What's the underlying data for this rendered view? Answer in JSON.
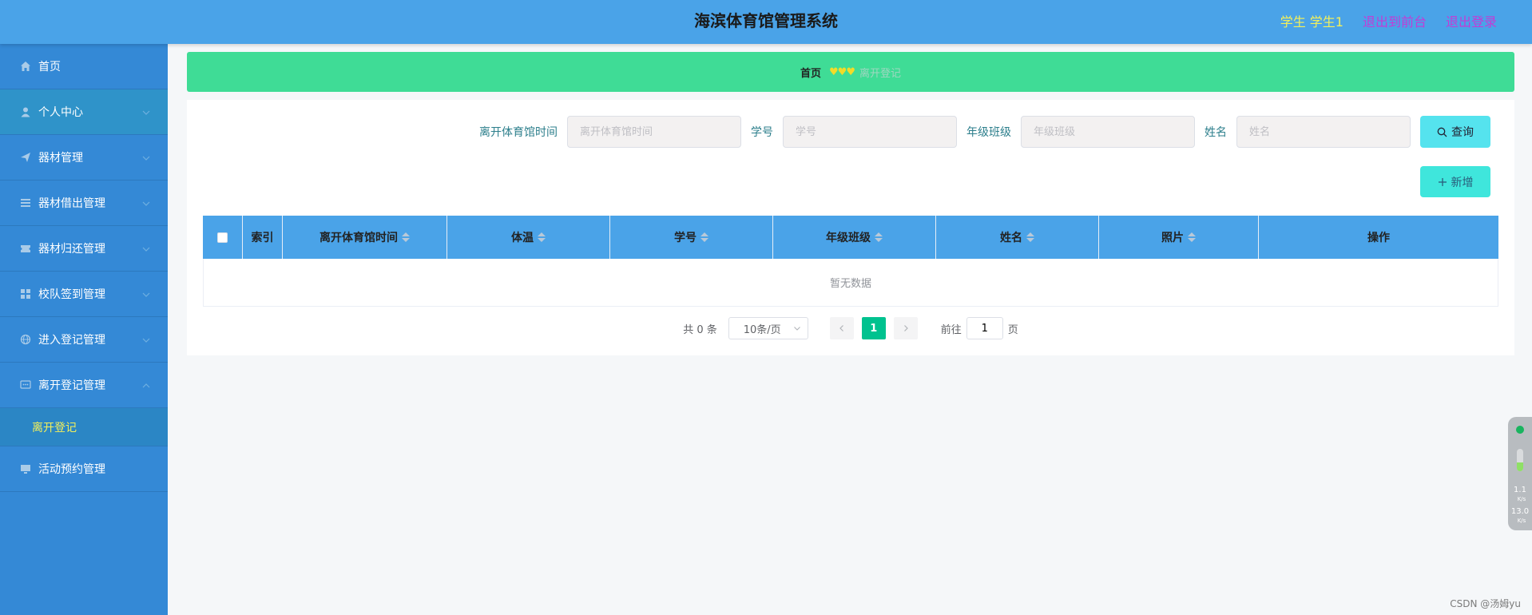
{
  "header": {
    "title": "海滨体育馆管理系统",
    "user": "学生 学生1",
    "exit_front": "退出到前台",
    "logout": "退出登录",
    "colors": {
      "bg": "#4aa3e8",
      "user": "#f4f05a",
      "link": "#c33bd6"
    }
  },
  "sidebar": {
    "items": [
      {
        "label": "首页",
        "icon": "home-icon"
      },
      {
        "label": "个人中心",
        "icon": "user-icon"
      },
      {
        "label": "器材管理",
        "icon": "send-icon"
      },
      {
        "label": "器材借出管理",
        "icon": "list-icon"
      },
      {
        "label": "器材归还管理",
        "icon": "ticket-icon"
      },
      {
        "label": "校队签到管理",
        "icon": "grid-icon"
      },
      {
        "label": "进入登记管理",
        "icon": "globe-icon"
      },
      {
        "label": "离开登记管理",
        "icon": "chat-icon"
      },
      {
        "label": "活动预约管理",
        "icon": "monitor-icon"
      }
    ],
    "sub_item": "离开登记"
  },
  "breadcrumb": {
    "home": "首页",
    "hearts": "♥♥♥",
    "current": "离开登记"
  },
  "search": {
    "fields": [
      {
        "label": "离开体育馆时间",
        "placeholder": "离开体育馆时间"
      },
      {
        "label": "学号",
        "placeholder": "学号"
      },
      {
        "label": "年级班级",
        "placeholder": "年级班级"
      },
      {
        "label": "姓名",
        "placeholder": "姓名"
      }
    ],
    "query_label": "查询",
    "add_label": "新增"
  },
  "table": {
    "columns": [
      "索引",
      "离开体育馆时间",
      "体温",
      "学号",
      "年级班级",
      "姓名",
      "照片",
      "操作"
    ],
    "empty_text": "暂无数据"
  },
  "pagination": {
    "total": "共 0 条",
    "page_size": "10条/页",
    "current_page": "1",
    "goto_label": "前往",
    "goto_value": "1",
    "page_unit": "页"
  },
  "widget": {
    "up_value": "1.1",
    "up_unit": "K/s",
    "down_value": "13.0",
    "down_unit": "K/s",
    "level": 0.4
  },
  "watermark": "CSDN @汤姆yu"
}
